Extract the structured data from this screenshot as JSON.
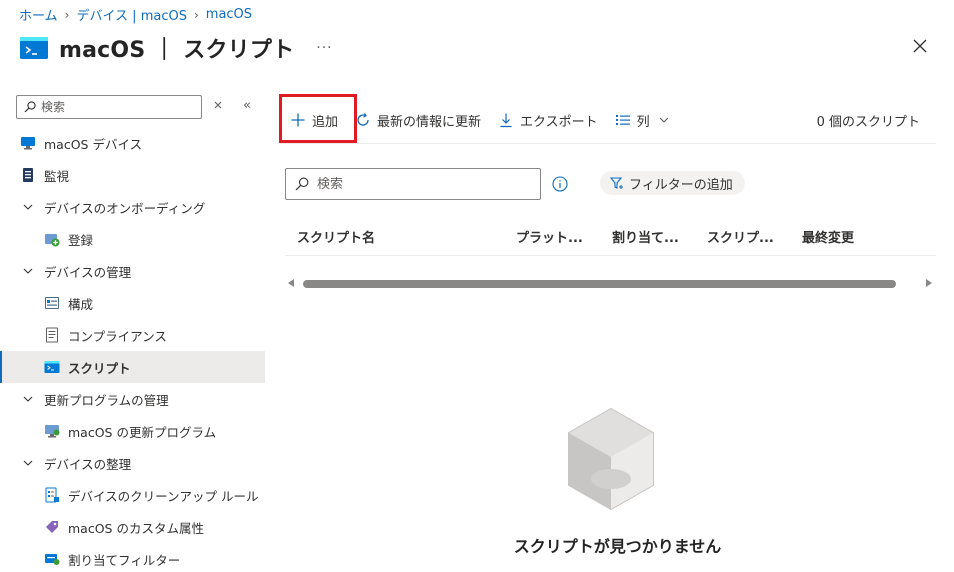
{
  "breadcrumb": {
    "items": [
      "ホーム",
      "デバイス | macOS",
      "macOS"
    ]
  },
  "header": {
    "title": "macOS ｜ スクリプト",
    "more_label": "···"
  },
  "sidebar": {
    "search_placeholder": "検索",
    "collapse_label": "«",
    "items": [
      {
        "label": "macOS デバイス"
      },
      {
        "label": "監視"
      },
      {
        "label": "デバイスのオンボーディング"
      },
      {
        "label": "登録"
      },
      {
        "label": "デバイスの管理"
      },
      {
        "label": "構成"
      },
      {
        "label": "コンプライアンス"
      },
      {
        "label": "スクリプト"
      },
      {
        "label": "更新プログラムの管理"
      },
      {
        "label": "macOS の更新プログラム"
      },
      {
        "label": "デバイスの整理"
      },
      {
        "label": "デバイスのクリーンアップ ルール"
      },
      {
        "label": "macOS のカスタム属性"
      },
      {
        "label": "割り当てフィルター"
      }
    ]
  },
  "toolbar": {
    "add_label": "追加",
    "refresh_label": "最新の情報に更新",
    "export_label": "エクスポート",
    "columns_label": "列",
    "script_count": "0 個のスクリプト"
  },
  "search": {
    "placeholder": "検索"
  },
  "filter": {
    "label": "フィルターの追加"
  },
  "table": {
    "columns": [
      "スクリプト名",
      "プラット...",
      "割り当て...",
      "スクリプ...",
      "最終変更"
    ]
  },
  "empty_state": {
    "message": "スクリプトが見つかりません"
  },
  "colors": {
    "accent": "#0f6cbd",
    "highlight": "#e01b24",
    "active_bg": "#edebe9"
  }
}
